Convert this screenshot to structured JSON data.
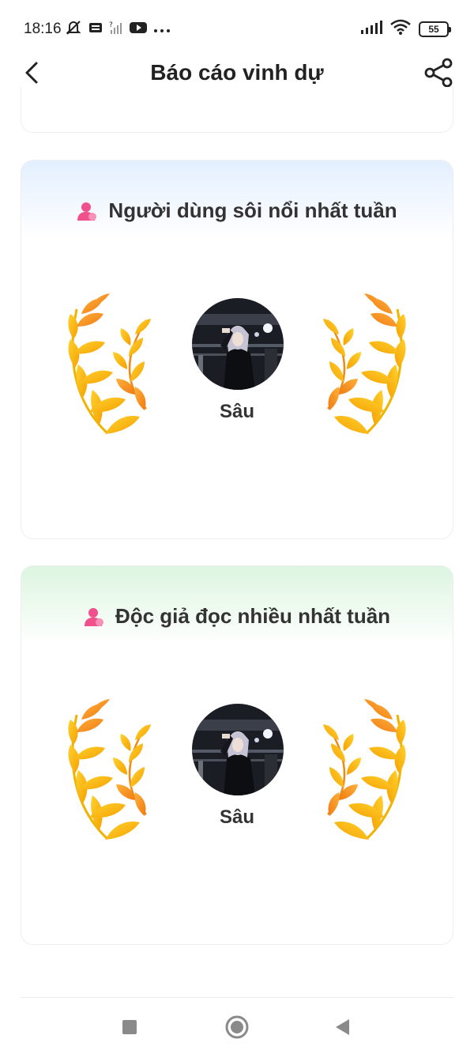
{
  "status_bar": {
    "time": "18:16",
    "battery": "55",
    "icons": [
      "mute-icon",
      "sim-icon",
      "no-signal-icon",
      "youtube-icon",
      "more-icon",
      "signal-icon",
      "wifi-icon",
      "battery-icon"
    ]
  },
  "header": {
    "title": "Báo cáo vinh dự",
    "back_icon": "chevron-left-icon",
    "share_icon": "share-icon"
  },
  "cards": [
    {
      "title": "Người dùng sôi nổi nhất tuần",
      "winner_name": "Sâu",
      "accent": "#e3efff"
    },
    {
      "title": "Độc giả đọc nhiều nhất tuần",
      "winner_name": "Sâu",
      "accent": "#dcf5e0"
    }
  ],
  "colors": {
    "laurel_gold": "#f5b800",
    "laurel_orange": "#f08a14",
    "user_icon_pink": "#f0508c"
  },
  "nav": {
    "icons": [
      "recents-square-icon",
      "home-circle-icon",
      "back-triangle-icon"
    ]
  }
}
